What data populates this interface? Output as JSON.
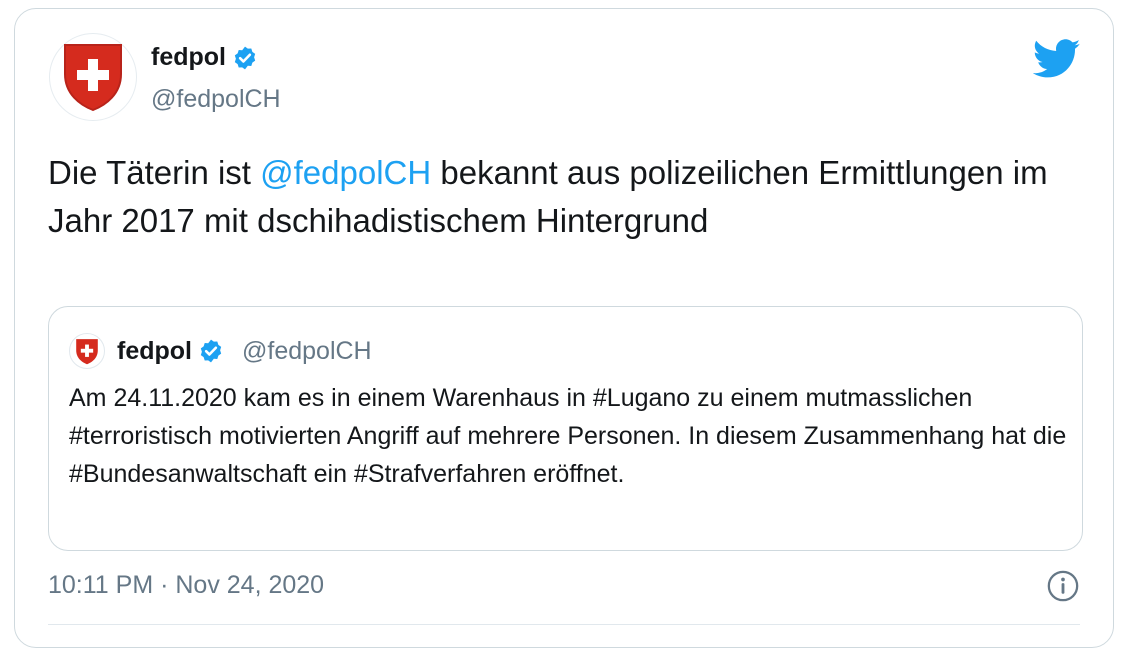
{
  "tweet": {
    "author_name": "fedpol",
    "author_handle": "@fedpolCH",
    "text_before": "Die Täterin ist ",
    "mention": "@fedpolCH",
    "text_after": " bekannt aus polizeilichen Ermittlungen im Jahr 2017 mit dschihadistischem Hintergrund",
    "timestamp": "10:11 PM · Nov 24, 2020"
  },
  "quoted": {
    "author_name": "fedpol",
    "author_handle": "@fedpolCH",
    "text": "Am 24.11.2020 kam es in einem Warenhaus in #Lugano zu einem mutmasslichen #terroristisch motivierten Angriff auf mehrere Personen. In diesem Zusammenhang hat die #Bundesanwaltschaft ein #Strafverfahren eröffnet."
  },
  "icons": {
    "avatar": "swiss-shield-icon",
    "verified": "verified-badge-icon",
    "brand": "twitter-bird-icon",
    "info": "info-icon"
  },
  "colors": {
    "link": "#1da1f2",
    "shield_red": "#d52b1e",
    "muted_text": "#657786",
    "border": "#cfd9de"
  }
}
